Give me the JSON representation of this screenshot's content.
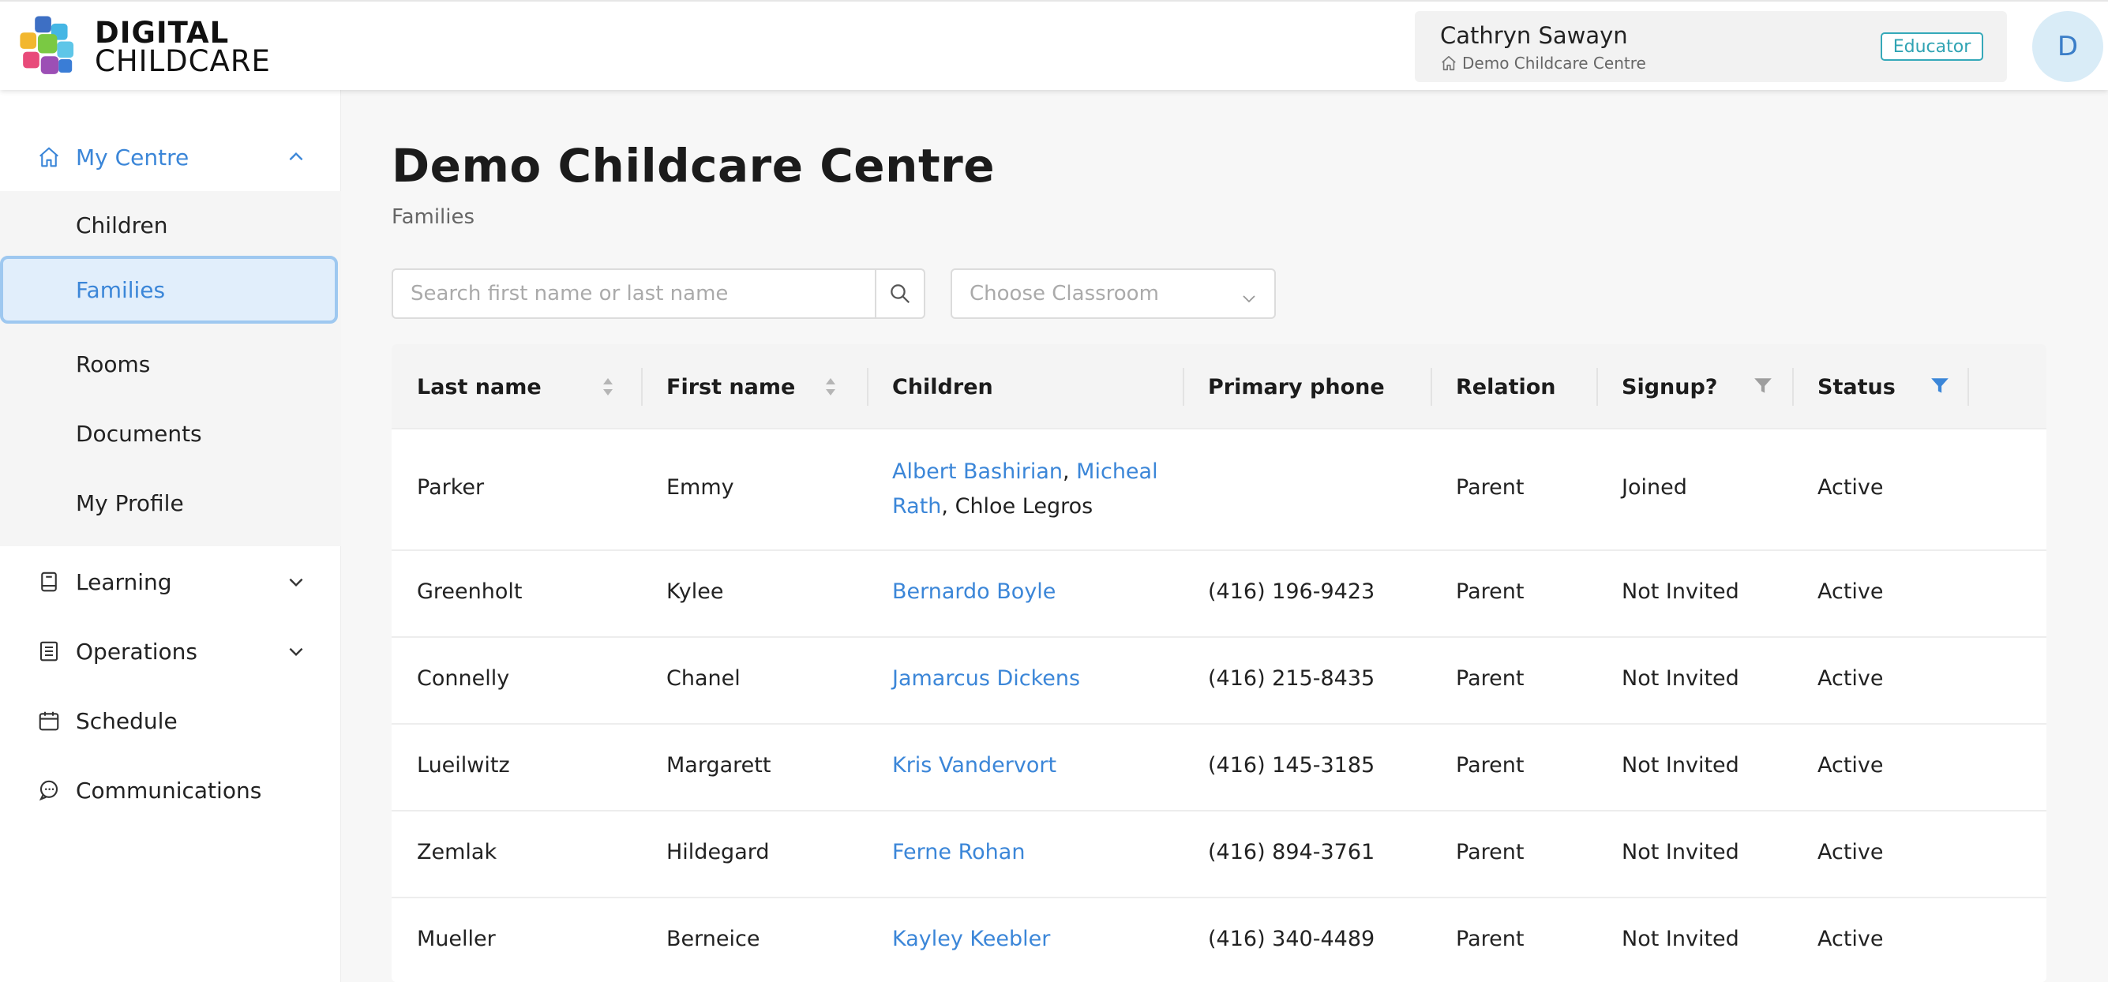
{
  "brand": {
    "line1": "DIGITAL",
    "line2": "CHILDCARE"
  },
  "user": {
    "name": "Cathryn Sawayn",
    "centre": "Demo Childcare Centre",
    "role": "Educator",
    "avatar_initial": "D"
  },
  "sidebar": {
    "my_centre": {
      "label": "My Centre",
      "items": [
        {
          "label": "Children"
        },
        {
          "label": "Families"
        },
        {
          "label": "Rooms"
        },
        {
          "label": "Documents"
        },
        {
          "label": "My Profile"
        }
      ]
    },
    "learning": {
      "label": "Learning"
    },
    "operations": {
      "label": "Operations"
    },
    "schedule": {
      "label": "Schedule"
    },
    "communications": {
      "label": "Communications"
    }
  },
  "page": {
    "title": "Demo Childcare Centre",
    "subtitle": "Families"
  },
  "search": {
    "placeholder": "Search first name or last name"
  },
  "classroom": {
    "placeholder": "Choose Classroom"
  },
  "table": {
    "headers": {
      "last_name": "Last name",
      "first_name": "First name",
      "children": "Children",
      "primary_phone": "Primary phone",
      "relation": "Relation",
      "signup": "Signup?",
      "status": "Status"
    },
    "rows": [
      {
        "last": "Parker",
        "first": "Emmy",
        "children": [
          {
            "name": "Albert Bashirian",
            "linked": true
          },
          {
            "name": "Micheal Rath",
            "linked": true
          },
          {
            "name": "Chloe Legros",
            "linked": false
          }
        ],
        "phone": "",
        "relation": "Parent",
        "signup": "Joined",
        "status": "Active"
      },
      {
        "last": "Greenholt",
        "first": "Kylee",
        "children": [
          {
            "name": "Bernardo Boyle",
            "linked": true
          }
        ],
        "phone": "(416) 196-9423",
        "relation": "Parent",
        "signup": "Not Invited",
        "status": "Active"
      },
      {
        "last": "Connelly",
        "first": "Chanel",
        "children": [
          {
            "name": "Jamarcus Dickens",
            "linked": true
          }
        ],
        "phone": "(416) 215-8435",
        "relation": "Parent",
        "signup": "Not Invited",
        "status": "Active"
      },
      {
        "last": "Lueilwitz",
        "first": "Margarett",
        "children": [
          {
            "name": "Kris Vandervort",
            "linked": true
          }
        ],
        "phone": "(416) 145-3185",
        "relation": "Parent",
        "signup": "Not Invited",
        "status": "Active"
      },
      {
        "last": "Zemlak",
        "first": "Hildegard",
        "children": [
          {
            "name": "Ferne Rohan",
            "linked": true
          }
        ],
        "phone": "(416) 894-3761",
        "relation": "Parent",
        "signup": "Not Invited",
        "status": "Active"
      },
      {
        "last": "Mueller",
        "first": "Berneice",
        "children": [
          {
            "name": "Kayley Keebler",
            "linked": true
          }
        ],
        "phone": "(416) 340-4489",
        "relation": "Parent",
        "signup": "Not Invited",
        "status": "Active"
      }
    ]
  },
  "colors": {
    "accent": "#3b86d8",
    "badge": "#2fa3b3",
    "active_filter": "#3b86d8",
    "inactive_filter": "#9e9e9e"
  }
}
